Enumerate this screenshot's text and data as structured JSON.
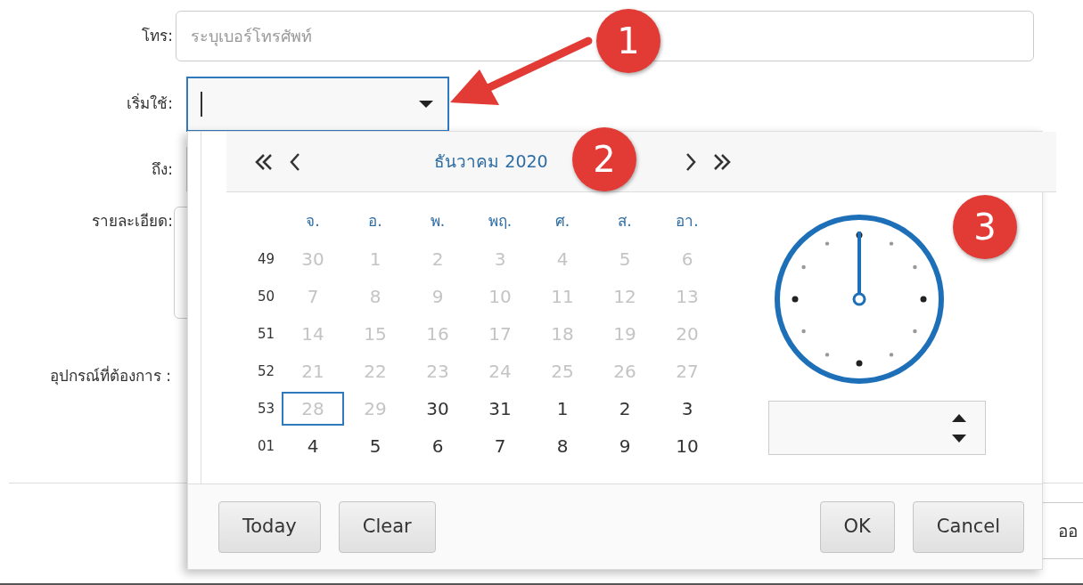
{
  "form": {
    "fields": [
      {
        "kind": "text",
        "label": "โทร:",
        "placeholder": "ระบุเบอร์โทรศัพท์"
      },
      {
        "kind": "datetime",
        "label": "เริ่มใช้:",
        "focused": true
      },
      {
        "kind": "covered",
        "label": "ถึง:"
      },
      {
        "kind": "textarea",
        "label": "รายละเอียด:"
      },
      {
        "kind": "none",
        "label": "อุปกรณ์ที่ต้องการ :"
      }
    ],
    "footer_button": "ออ"
  },
  "picker": {
    "title": "ธันวาคม 2020",
    "weekdays": [
      "จ.",
      "อ.",
      "พ.",
      "พฤ.",
      "ศ.",
      "ส.",
      "อา."
    ],
    "weeks": [
      {
        "week": "49",
        "days": [
          {
            "text": "30",
            "muted": true,
            "focused": false
          },
          {
            "text": "1",
            "muted": true,
            "focused": false
          },
          {
            "text": "2",
            "muted": true,
            "focused": false
          },
          {
            "text": "3",
            "muted": true,
            "focused": false
          },
          {
            "text": "4",
            "muted": true,
            "focused": false
          },
          {
            "text": "5",
            "muted": true,
            "focused": false
          },
          {
            "text": "6",
            "muted": true,
            "focused": false
          }
        ]
      },
      {
        "week": "50",
        "days": [
          {
            "text": "7",
            "muted": true,
            "focused": false
          },
          {
            "text": "8",
            "muted": true,
            "focused": false
          },
          {
            "text": "9",
            "muted": true,
            "focused": false
          },
          {
            "text": "10",
            "muted": true,
            "focused": false
          },
          {
            "text": "11",
            "muted": true,
            "focused": false
          },
          {
            "text": "12",
            "muted": true,
            "focused": false
          },
          {
            "text": "13",
            "muted": true,
            "focused": false
          }
        ]
      },
      {
        "week": "51",
        "days": [
          {
            "text": "14",
            "muted": true,
            "focused": false
          },
          {
            "text": "15",
            "muted": true,
            "focused": false
          },
          {
            "text": "16",
            "muted": true,
            "focused": false
          },
          {
            "text": "17",
            "muted": true,
            "focused": false
          },
          {
            "text": "18",
            "muted": true,
            "focused": false
          },
          {
            "text": "19",
            "muted": true,
            "focused": false
          },
          {
            "text": "20",
            "muted": true,
            "focused": false
          }
        ]
      },
      {
        "week": "52",
        "days": [
          {
            "text": "21",
            "muted": true,
            "focused": false
          },
          {
            "text": "22",
            "muted": true,
            "focused": false
          },
          {
            "text": "23",
            "muted": true,
            "focused": false
          },
          {
            "text": "24",
            "muted": true,
            "focused": false
          },
          {
            "text": "25",
            "muted": true,
            "focused": false
          },
          {
            "text": "26",
            "muted": true,
            "focused": false
          },
          {
            "text": "27",
            "muted": true,
            "focused": false
          }
        ]
      },
      {
        "week": "53",
        "days": [
          {
            "text": "28",
            "muted": true,
            "focused": true
          },
          {
            "text": "29",
            "muted": true,
            "focused": false
          },
          {
            "text": "30",
            "muted": false,
            "focused": false
          },
          {
            "text": "31",
            "muted": false,
            "focused": false
          },
          {
            "text": "1",
            "muted": false,
            "focused": false
          },
          {
            "text": "2",
            "muted": false,
            "focused": false
          },
          {
            "text": "3",
            "muted": false,
            "focused": false
          }
        ]
      },
      {
        "week": "01",
        "days": [
          {
            "text": "4",
            "muted": false,
            "focused": false
          },
          {
            "text": "5",
            "muted": false,
            "focused": false
          },
          {
            "text": "6",
            "muted": false,
            "focused": false
          },
          {
            "text": "7",
            "muted": false,
            "focused": false
          },
          {
            "text": "8",
            "muted": false,
            "focused": false
          },
          {
            "text": "9",
            "muted": false,
            "focused": false
          },
          {
            "text": "10",
            "muted": false,
            "focused": false
          }
        ]
      }
    ],
    "buttons_left": [
      "Today",
      "Clear"
    ],
    "buttons_right": [
      "OK",
      "Cancel"
    ]
  },
  "annotations": [
    "1",
    "2",
    "3"
  ]
}
